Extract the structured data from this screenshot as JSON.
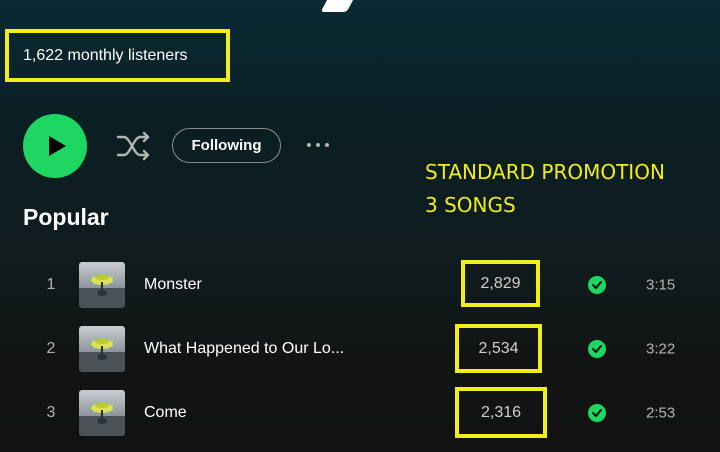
{
  "artist": {
    "monthly_listeners": "1,622 monthly listeners"
  },
  "controls": {
    "play_icon": "play-icon",
    "shuffle_icon": "shuffle-icon",
    "following_label": "Following",
    "more_icon": "more-options-icon"
  },
  "promo": {
    "line1": "STANDARD PROMOTION",
    "line2": "3 SONGS",
    "highlight_color": "#f2ee1a"
  },
  "popular": {
    "title": "Popular",
    "tracks": [
      {
        "number": "1",
        "title": "Monster",
        "plays": "2,829",
        "duration": "3:15",
        "saved": true
      },
      {
        "number": "2",
        "title": "What Happened to Our Lo...",
        "plays": "2,534",
        "duration": "3:22",
        "saved": true
      },
      {
        "number": "3",
        "title": "Come",
        "plays": "2,316",
        "duration": "2:53",
        "saved": true
      }
    ]
  },
  "colors": {
    "accent": "#1ed760",
    "text_secondary": "#b3b3b3"
  }
}
